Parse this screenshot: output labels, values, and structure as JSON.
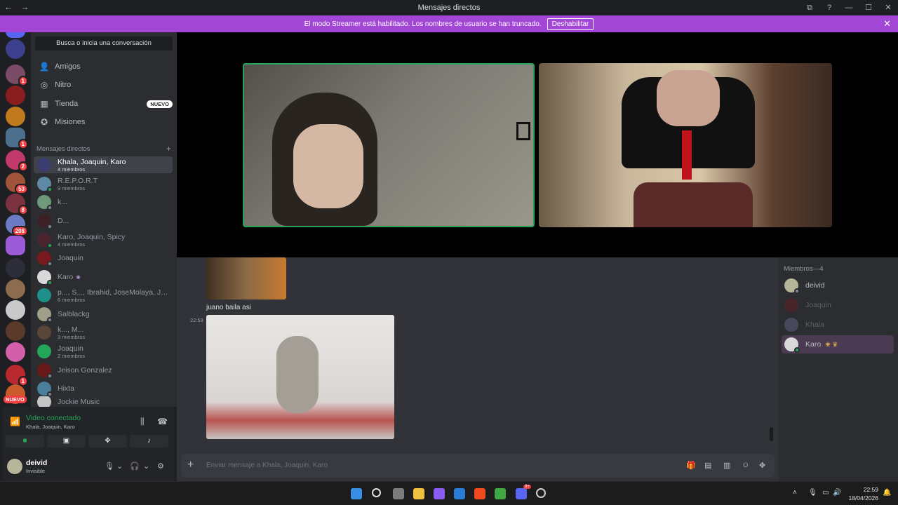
{
  "window": {
    "title": "Mensajes directos",
    "back": "←",
    "forward": "→",
    "controls": [
      "⧉",
      "?",
      "—",
      "☐",
      "✕"
    ]
  },
  "banner": {
    "text": "El modo Streamer está habilitado. Los nombres de usuario se han truncado.",
    "button": "Deshabilitar",
    "close": "✕"
  },
  "guild_badges": [
    "1",
    "2",
    "53",
    "8",
    "208",
    "1",
    "1",
    "NUEVO"
  ],
  "sidebar": {
    "search_placeholder": "Busca o inicia una conversación",
    "nav": [
      {
        "label": "Amigos",
        "icon": "friends-icon"
      },
      {
        "label": "Nitro",
        "icon": "nitro-icon"
      },
      {
        "label": "Tienda",
        "icon": "shop-icon",
        "tag": "NUEVO"
      },
      {
        "label": "Misiones",
        "icon": "quests-icon"
      }
    ],
    "dm_header": "Mensajes directos",
    "dm_add": "+",
    "dms": [
      {
        "name": "Khala, Joaquin, Karo",
        "sub": "4 miembros",
        "selected": true
      },
      {
        "name": "R.E.P.O.R.T",
        "sub": "9 miembros"
      },
      {
        "name": "k..."
      },
      {
        "name": "D..."
      },
      {
        "name": "Karo, Joaquin, Spicy",
        "sub": "4 miembros"
      },
      {
        "name": "Joaquin"
      },
      {
        "name": "Karo",
        "badge": "❀"
      },
      {
        "name": "p..., S..., Ibrahid, JoseMolaya, Jud...",
        "sub": "6 miembros"
      },
      {
        "name": "Salblackg"
      },
      {
        "name": "k..., M...",
        "sub": "3 miembros"
      },
      {
        "name": "Joaquin",
        "sub": "2 miembros"
      },
      {
        "name": "Jeison Gonzalez"
      },
      {
        "name": "Hixta"
      },
      {
        "name": "Jockie Music"
      }
    ]
  },
  "voice": {
    "status": "Video conectado",
    "channel": "Khala, Joaquin, Karo"
  },
  "user": {
    "name": "deivid",
    "status": "Invisible"
  },
  "chat": {
    "gif_caption": "juano baila asi",
    "timestamp": "22:59",
    "composer_placeholder": "Enviar mensaje a Khala, Joaquin, Karo"
  },
  "members": {
    "header": "Miembros—4",
    "list": [
      {
        "name": "deivid",
        "state": "self"
      },
      {
        "name": "Joaquin",
        "state": "offline"
      },
      {
        "name": "Khala",
        "state": "offline"
      },
      {
        "name": "Karo",
        "state": "online",
        "badges": "❀ ♛"
      }
    ]
  },
  "taskbar": {
    "time": "22:59",
    "date": "18/04/2026",
    "discord_badge": "9+"
  }
}
